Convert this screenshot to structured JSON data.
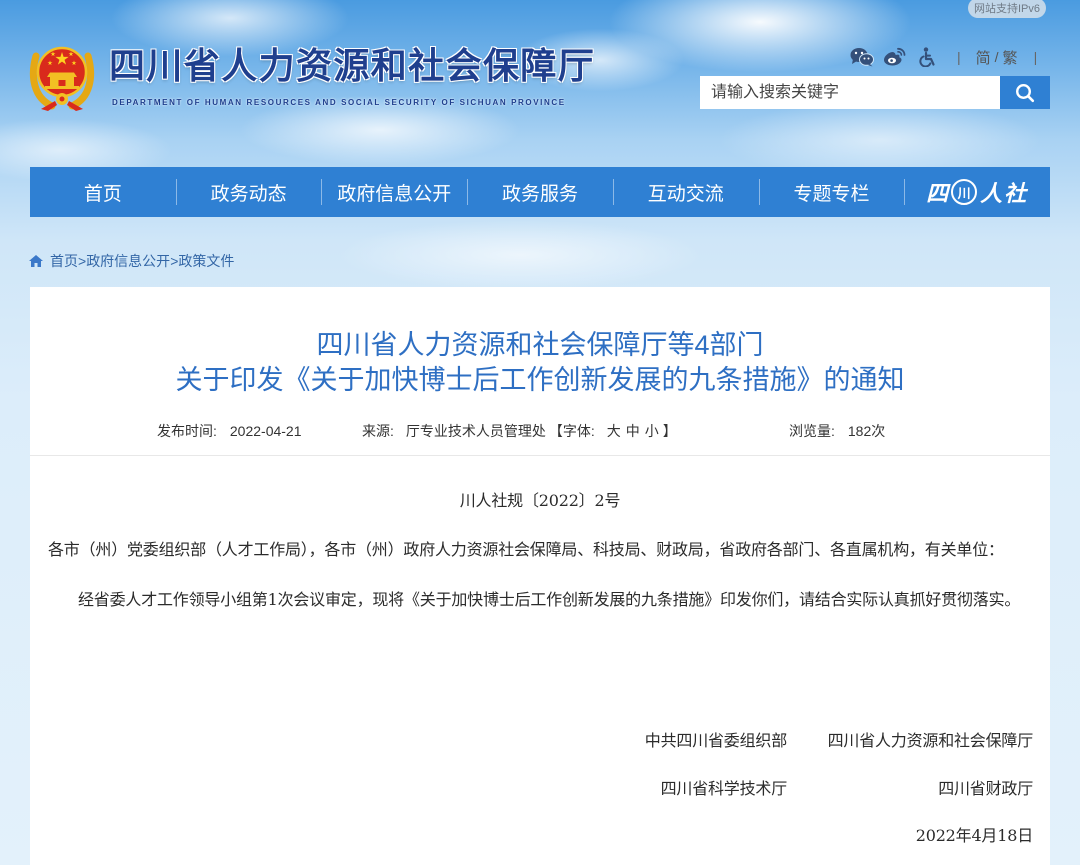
{
  "theme": {
    "accent": "#2f80d3",
    "site_title_color": "#1f3f8e",
    "article_title_color": "#2e6fc3",
    "breadcrumb_color": "#3366a6"
  },
  "header": {
    "ipv6_badge": "网站支持IPv6",
    "site_title": "四川省人力资源和社会保障厅",
    "site_subtitle_en": "DEPARTMENT OF HUMAN RESOURCES AND SOCIAL SECURITY OF SICHUAN PROVINCE",
    "emblem_icon": "national-emblem-icon",
    "icons": {
      "wechat": "wechat-icon",
      "weibo": "weibo-icon",
      "accessibility": "accessibility-icon"
    },
    "tools": {
      "divider": "|",
      "simplified": "简",
      "slash": "/",
      "traditional": "繁"
    },
    "search": {
      "placeholder": "请输入搜索关键字",
      "value": "",
      "button_icon": "search-icon"
    }
  },
  "nav": {
    "items": [
      {
        "label": "首页"
      },
      {
        "label": "政务动态"
      },
      {
        "label": "政府信息公开"
      },
      {
        "label": "政务服务"
      },
      {
        "label": "互动交流"
      },
      {
        "label": "专题专栏"
      }
    ],
    "brand": {
      "part1": "四",
      "part2": "川",
      "part3": "人社"
    }
  },
  "breadcrumb": {
    "home_icon": "home-icon",
    "separator": ">",
    "items": [
      "首页",
      "政府信息公开",
      "政策文件"
    ]
  },
  "article": {
    "title_line1": "四川省人力资源和社会保障厅等4部门",
    "title_line2": "关于印发《关于加快博士后工作创新发展的九条措施》的通知",
    "meta": {
      "publish_label": "发布时间:",
      "publish_date": "2022-04-21",
      "source_label": "来源:",
      "source": "厅专业技术人员管理处",
      "font_open": "【字体:",
      "font_sizes": [
        "大",
        "中",
        "小"
      ],
      "font_close": "】",
      "views_label": "浏览量:",
      "views": "182次"
    },
    "doc_number": "川人社规〔2022〕2号",
    "salutation": "各市（州）党委组织部（人才工作局），各市（州）政府人力资源社会保障局、科技局、财政局，省政府各部门、各直属机构，有关单位：",
    "paragraphs": [
      "经省委人才工作领导小组第1次会议审定，现将《关于加快博士后工作创新发展的九条措施》印发你们，请结合实际认真抓好贯彻落实。"
    ],
    "signatories": [
      [
        "中共四川省委组织部",
        "四川省人力资源和社会保障厅"
      ],
      [
        "四川省科学技术厅",
        "四川省财政厅"
      ]
    ],
    "date": "2022年4月18日"
  }
}
